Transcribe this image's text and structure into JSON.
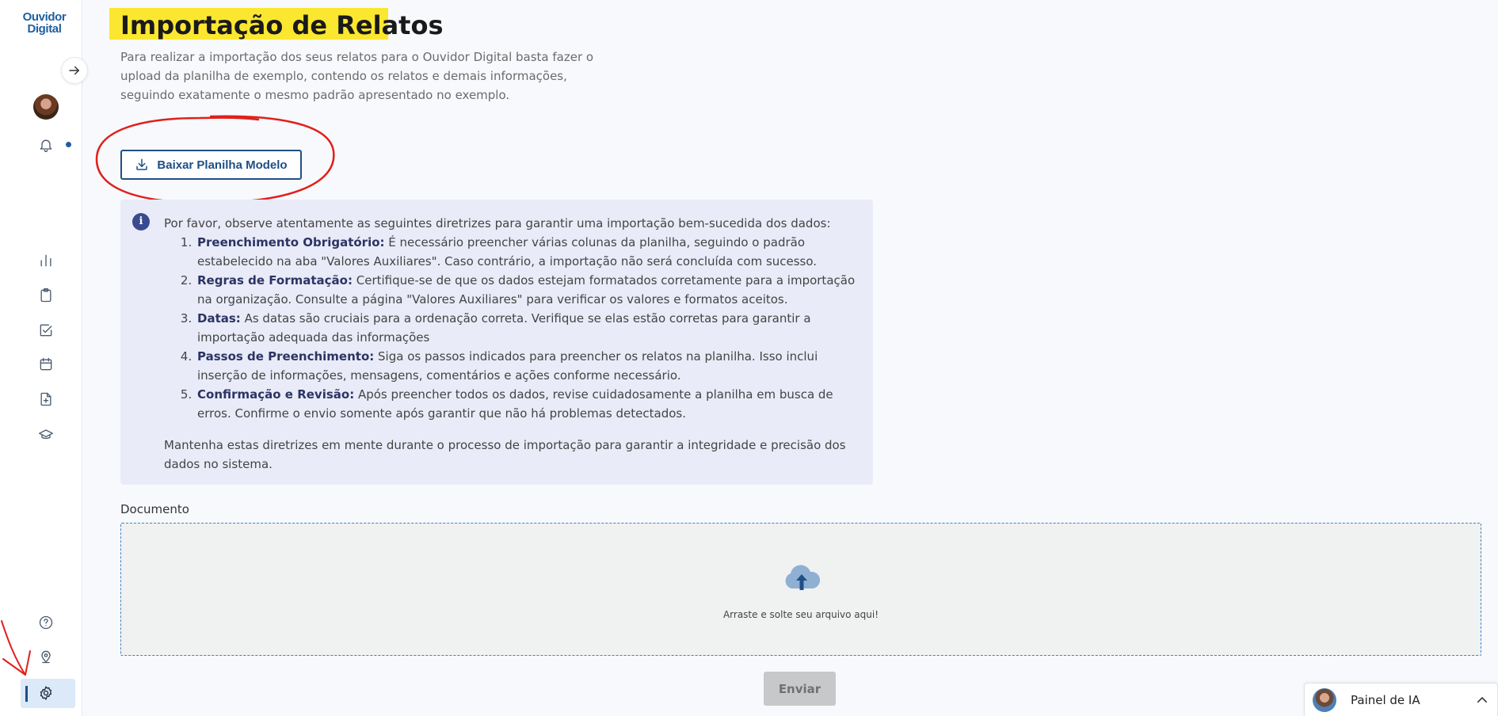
{
  "sidebar": {
    "logo_line1": "Ouvidor",
    "logo_line2": "Digital",
    "icons": [
      "arrow-right-icon",
      "bell-icon",
      "bar-chart-icon",
      "clipboard-icon",
      "checkbox-icon",
      "calendar-icon",
      "file-plus-icon",
      "graduation-cap-icon",
      "help-circle-icon",
      "location-pin-icon",
      "gear-icon"
    ]
  },
  "page": {
    "title": "Importação de Relatos",
    "intro": "Para realizar a importação dos seus relatos para o Ouvidor Digital basta fazer o upload da planilha de exemplo, contendo os relatos e demais informações, seguindo exatamente o mesmo padrão apresentado no exemplo.",
    "download_button": "Baixar Planilha Modelo"
  },
  "guidelines": {
    "intro": "Por favor, observe atentamente as seguintes diretrizes para garantir uma importação bem-sucedida dos dados:",
    "items": [
      {
        "title": "Preenchimento Obrigatório:",
        "text": " É necessário preencher várias colunas da planilha, seguindo o padrão estabelecido na aba \"Valores Auxiliares\". Caso contrário, a importação não será concluída com sucesso."
      },
      {
        "title": "Regras de Formatação:",
        "text": " Certifique-se de que os dados estejam formatados corretamente para a importação na organização. Consulte a página \"Valores Auxiliares\" para verificar os valores e formatos aceitos."
      },
      {
        "title": "Datas:",
        "text": " As datas são cruciais para a ordenação correta. Verifique se elas estão corretas para garantir a importação adequada das informações"
      },
      {
        "title": "Passos de Preenchimento:",
        "text": " Siga os passos indicados para preencher os relatos na planilha. Isso inclui inserção de informações, mensagens, comentários e ações conforme necessário."
      },
      {
        "title": "Confirmação e Revisão:",
        "text": " Após preencher todos os dados, revise cuidadosamente a planilha em busca de erros. Confirme o envio somente após garantir que não há problemas detectados."
      }
    ],
    "closing": "Mantenha estas diretrizes em mente durante o processo de importação para garantir a integridade e precisão dos dados no sistema."
  },
  "upload": {
    "label": "Documento",
    "drop_text": "Arraste e solte seu arquivo aqui!",
    "submit": "Enviar"
  },
  "ai_panel": {
    "label": "Painel de IA"
  },
  "colors": {
    "brand": "#1f4f86",
    "highlight": "#fbe72f",
    "annotation": "#e0201c",
    "info_bg": "#e9ebf8"
  }
}
